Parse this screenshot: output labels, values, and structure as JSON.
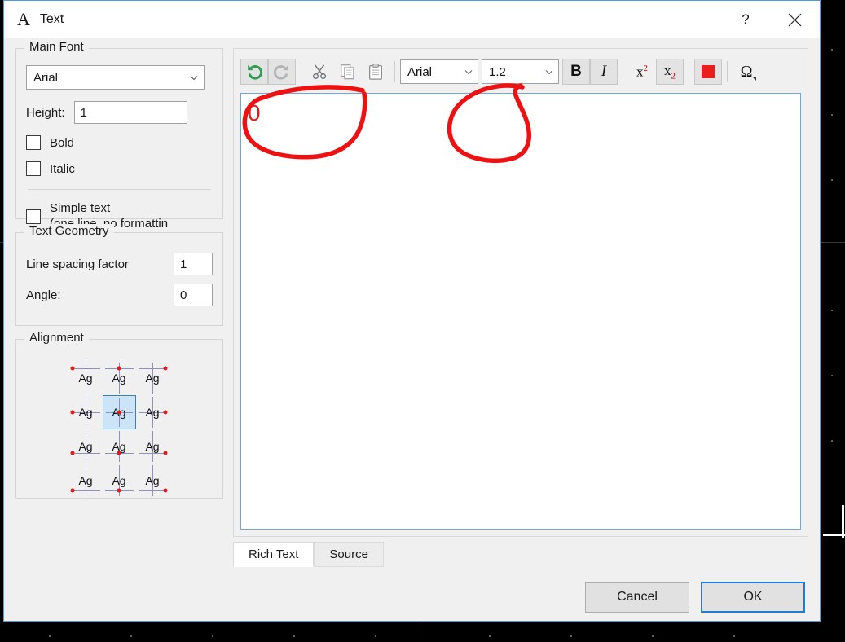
{
  "window": {
    "title": "Text",
    "icon": "letter-a-icon",
    "help_label": "?",
    "close_label": "✕"
  },
  "left_panel": {
    "main_font": {
      "group_title": "Main Font",
      "font_combo": {
        "value": "Arial",
        "icon": "chevron-down-icon"
      },
      "height_label": "Height:",
      "height_value": "1",
      "bold_label": "Bold",
      "bold_checked": false,
      "italic_label": "Italic",
      "italic_checked": false,
      "simple_text_label": "Simple text\n(one line, no formattin",
      "simple_text_line1": "Simple text",
      "simple_text_line2": "(one line, no formattin",
      "simple_text_checked": false
    },
    "text_geometry": {
      "group_title": "Text Geometry",
      "line_spacing_label": "Line spacing factor",
      "line_spacing_value": "1",
      "angle_label": "Angle:",
      "angle_value": "0"
    },
    "alignment": {
      "group_title": "Alignment",
      "cell_label": "Ag",
      "selected_index": 4,
      "cells": [
        {
          "name": "align-top-left",
          "vpos": "top",
          "hpos": "left"
        },
        {
          "name": "align-top-center",
          "vpos": "top",
          "hpos": "center"
        },
        {
          "name": "align-top-right",
          "vpos": "top",
          "hpos": "right"
        },
        {
          "name": "align-middle-left",
          "vpos": "middle",
          "hpos": "left"
        },
        {
          "name": "align-middle-center",
          "vpos": "middle",
          "hpos": "center"
        },
        {
          "name": "align-middle-right",
          "vpos": "middle",
          "hpos": "right"
        },
        {
          "name": "align-base-left",
          "vpos": "baseline",
          "hpos": "left"
        },
        {
          "name": "align-base-center",
          "vpos": "baseline",
          "hpos": "center"
        },
        {
          "name": "align-base-right",
          "vpos": "baseline",
          "hpos": "right"
        },
        {
          "name": "align-bottom-left",
          "vpos": "bottom",
          "hpos": "left"
        },
        {
          "name": "align-bottom-center",
          "vpos": "bottom",
          "hpos": "center"
        },
        {
          "name": "align-bottom-right",
          "vpos": "bottom",
          "hpos": "right"
        }
      ]
    }
  },
  "editor": {
    "toolbar": {
      "undo": {
        "icon": "undo-arrow-icon",
        "enabled": true
      },
      "redo": {
        "icon": "redo-arrow-icon",
        "enabled": false
      },
      "cut": {
        "icon": "scissors-icon"
      },
      "copy": {
        "icon": "copy-pages-icon"
      },
      "paste": {
        "icon": "clipboard-icon"
      },
      "font_combo": {
        "value": "Arial",
        "icon": "chevron-down-icon"
      },
      "size_combo": {
        "value": "1.2",
        "icon": "chevron-down-icon"
      },
      "bold_label": "B",
      "italic_label": "I",
      "superscript_base": "x",
      "superscript_exp": "2",
      "subscript_base": "x",
      "subscript_idx": "2",
      "color_swatch": "#ec1c1c",
      "symbol_label": "Ω"
    },
    "content": "0",
    "content_color": "#e01b1b",
    "tabs": [
      {
        "label": "Rich Text",
        "active": true
      },
      {
        "label": "Source",
        "active": false
      }
    ]
  },
  "footer": {
    "cancel_label": "Cancel",
    "ok_label": "OK"
  },
  "annotations": {
    "color": "#ee1111",
    "marks": [
      {
        "name": "annotation-circle-size-combo",
        "target": "size_combo"
      },
      {
        "name": "annotation-circle-subscript-color",
        "target": "subscript_and_color"
      }
    ]
  }
}
